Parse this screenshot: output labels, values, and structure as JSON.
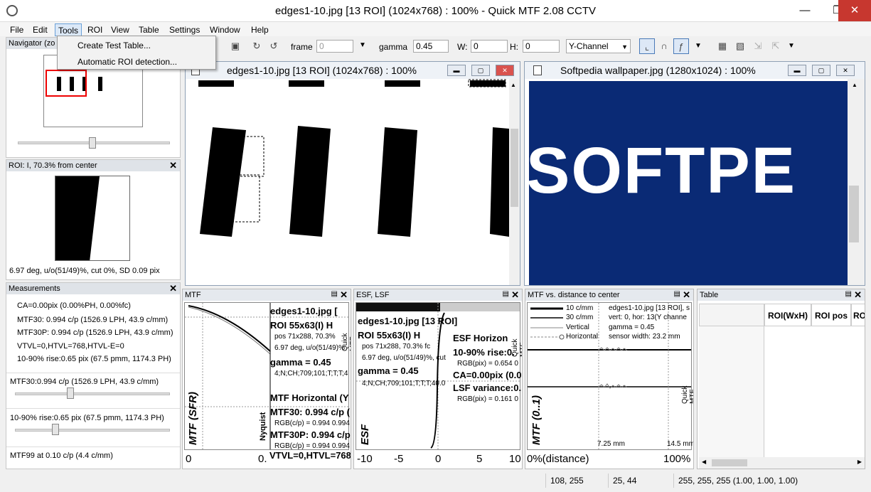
{
  "window": {
    "title": "edges1-10.jpg [13 ROI] (1024x768) : 100% - Quick MTF 2.08 CCTV"
  },
  "menubar": {
    "items": [
      "File",
      "Edit",
      "Tools",
      "ROI",
      "View",
      "Table",
      "Settings",
      "Window",
      "Help"
    ]
  },
  "tools_menu": {
    "items": [
      "Create Test Table...",
      "Automatic ROI detection..."
    ]
  },
  "toolbar": {
    "frame_label": "frame",
    "frame_value": "0",
    "gamma_label": "gamma",
    "gamma_value": "0.45",
    "w_label": "W:",
    "w_value": "0",
    "h_label": "H:",
    "h_value": "0",
    "channel": "Y-Channel"
  },
  "navigator": {
    "title": "Navigator (zo"
  },
  "roi_panel": {
    "title": "ROI: I, 70.3% from center",
    "caption": "6.97 deg, u/o(51/49)%, cut 0%, SD 0.09 pix"
  },
  "measurements": {
    "title": "Measurements",
    "lines": [
      "CA=0.00pix (0.00%PH, 0.00%fc)",
      "MTF30: 0.994 c/p (1526.9 LPH, 43.9 c/mm)",
      "MTF30P: 0.994 c/p (1526.9 LPH, 43.9 c/mm)",
      "VTVL=0,HTVL=768,HTVL-E=0",
      "10-90% rise:0.65 pix (67.5 pmm, 1174.3 PH)"
    ],
    "slider1_label": "MTF30:0.994 c/p (1526.9 LPH, 43.9 c/mm)",
    "slider1_value": 0.35,
    "slider2_label": "10-90% rise:0.65 pix (67.5 pmm, 1174.3 PH)",
    "slider2_value": 0.25,
    "mtf99_label": "MTF99 at 0.10 c/p (4.4 c/mm)"
  },
  "image1": {
    "title": "edges1-10.jpg [13 ROI] (1024x768) : 100%"
  },
  "image2": {
    "title": "Softpedia wallpaper.jpg (1280x1024) : 100%",
    "logo_text": "SOFTPE"
  },
  "mtf_panel": {
    "title": "MTF",
    "ylabel": "MTF (SFR)",
    "x0": "0",
    "x1": "0.",
    "nyquist": "Nyquist",
    "watermark": "Quick MTF",
    "lines": [
      "edges1-10.jpg [",
      "ROI 55x63(I) H",
      "pos 71x288, 70.3%",
      "6.97 deg, u/o(51/49)%",
      "gamma = 0.45",
      "4;N;CH;709;101;T;T;T;4",
      "MTF Horizontal (Y",
      "MTF30: 0.994 c/p (",
      "RGB(c/p) = 0.994 0.994",
      "MTF30P: 0.994 c/p",
      "RGB(c/p) = 0.994 0.994",
      "VTVL=0,HTVL=768"
    ]
  },
  "esf_panel": {
    "title": "ESF, LSF",
    "ylabel": "ESF",
    "ticks": [
      "-10",
      "-5",
      "0",
      "5",
      "10"
    ],
    "watermark": "Quick MTF",
    "lines": [
      "edges1-10.jpg [13 ROI]",
      "ROI 55x63(I) H",
      "pos 71x288, 70.3% fc",
      "6.97 deg, u/o(51/49)%, cut",
      "gamma = 0.45",
      "4;N;CH;709;101;T;T;T;40.0",
      "ESF Horizon",
      "10-90% rise:0.",
      "RGB(pix) = 0.654 0",
      "CA=0.00pix (0.0",
      "LSF variance:0.",
      "RGB(pix) = 0.161 0"
    ]
  },
  "dist_panel": {
    "title": "MTF vs. distance to center",
    "ylabel": "MTF (0..1)",
    "xlabel_left": "0%(distance)",
    "xlabel_right": "100%",
    "tick1": "7.25 mm",
    "tick2": "14.5 mm",
    "legend": [
      "10 c/mm",
      "30 c/mm",
      "Vertical",
      "Horizontal"
    ],
    "info": [
      "edges1-10.jpg [13 ROI], s",
      "vert: 0, hor: 13(Y channe",
      "gamma = 0.45",
      "sensor width: 23.2 mm"
    ],
    "watermark": "Quick MTF"
  },
  "table_panel": {
    "title": "Table",
    "headers": [
      "ROI(WxH)",
      "ROI pos",
      "RO"
    ]
  },
  "status": {
    "cells": [
      "108, 255",
      "25, 44",
      "255, 255, 255 (1.00, 1.00, 1.00)"
    ]
  }
}
